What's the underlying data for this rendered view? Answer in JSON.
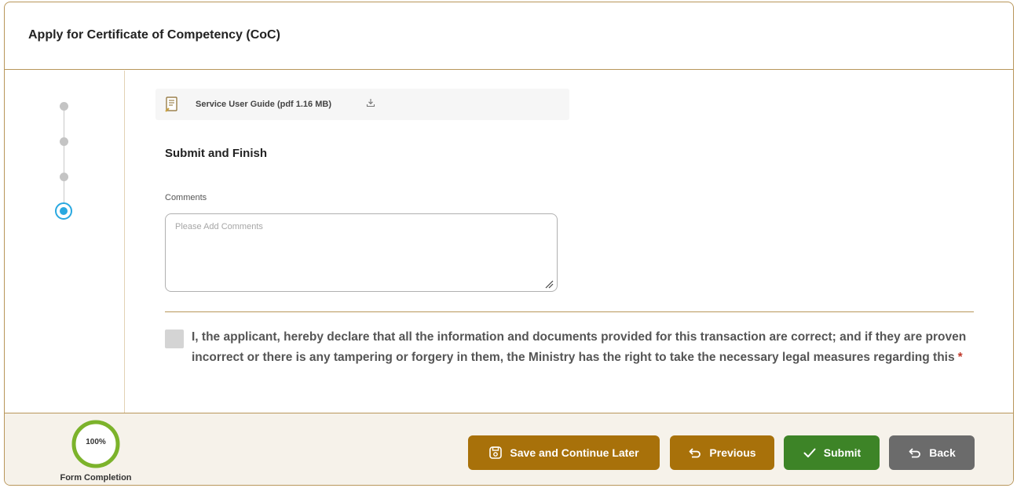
{
  "header": {
    "title": "Apply for Certificate of Competency (CoC)"
  },
  "stepper": {
    "total_steps": 4,
    "active_step": 4
  },
  "guide": {
    "label": "Service User Guide (pdf 1.16 MB)",
    "icon": "document-guide-icon",
    "download_icon": "download-icon"
  },
  "section": {
    "title": "Submit and Finish"
  },
  "comments": {
    "label": "Comments",
    "placeholder": "Please Add Comments",
    "value": ""
  },
  "declaration": {
    "text": "I, the applicant, hereby declare that all the information and documents provided for this transaction are correct; and if they are proven incorrect or there is any tampering or forgery in them, the Ministry has the right to take the necessary legal measures regarding this",
    "required_mark": "*",
    "checked": false
  },
  "footer": {
    "progress_value": "100%",
    "progress_fraction": 1.0,
    "progress_caption": "Form Completion",
    "buttons": {
      "save": "Save and Continue Later",
      "previous": "Previous",
      "submit": "Submit",
      "back": "Back"
    }
  },
  "colors": {
    "accent_border": "#b8965a",
    "brown_button": "#a8710a",
    "submit_green": "#3d8427",
    "back_gray": "#6b6b6b",
    "step_active": "#29a8e0",
    "progress_green": "#7cb32b"
  }
}
